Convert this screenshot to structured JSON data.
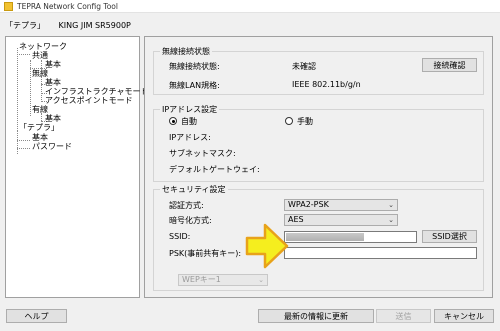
{
  "window": {
    "title": "TEPRA Network Config Tool"
  },
  "printer": {
    "bracket_name": "「テプラ」",
    "model": "KING JIM SR5900P"
  },
  "tree": {
    "network": "ネットワーク",
    "common": "共通",
    "common_basic": "基本",
    "wireless": "無線",
    "wireless_basic": "基本",
    "infrastructure": "インフラストラクチャモード",
    "access_point": "アクセスポイントモード",
    "wired": "有線",
    "wired_basic": "基本",
    "tepra": "「テプラ」",
    "tepra_basic": "基本",
    "password": "パスワード"
  },
  "wireless_status": {
    "title": "無線接続状態",
    "status_label": "無線接続状態:",
    "status_value": "未確認",
    "standard_label": "無線LAN規格:",
    "standard_value": "IEEE 802.11b/g/n",
    "check_button": "接続確認"
  },
  "ip": {
    "title": "IPアドレス設定",
    "auto": "自動",
    "manual": "手動",
    "selected": "auto",
    "address_label": "IPアドレス:",
    "subnet_label": "サブネットマスク:",
    "gateway_label": "デフォルトゲートウェイ:"
  },
  "security": {
    "title": "セキュリティ設定",
    "auth_label": "認証方式:",
    "auth_value": "WPA2-PSK",
    "encryption_label": "暗号化方式:",
    "encryption_value": "AES",
    "ssid_label": "SSID:",
    "ssid_select_button": "SSID選択",
    "psk_label": "PSK(事前共有キー):",
    "psk_value": "",
    "wep_key_value": "WEPキー1"
  },
  "footer": {
    "help_button": "ヘルプ",
    "refresh_button": "最新の情報に更新",
    "send_button": "送信",
    "cancel_button": "キャンセル"
  },
  "colors": {
    "arrow_fill": "#f5ee1e",
    "arrow_stroke": "#e8a21a",
    "app_icon": "#f2c230"
  }
}
